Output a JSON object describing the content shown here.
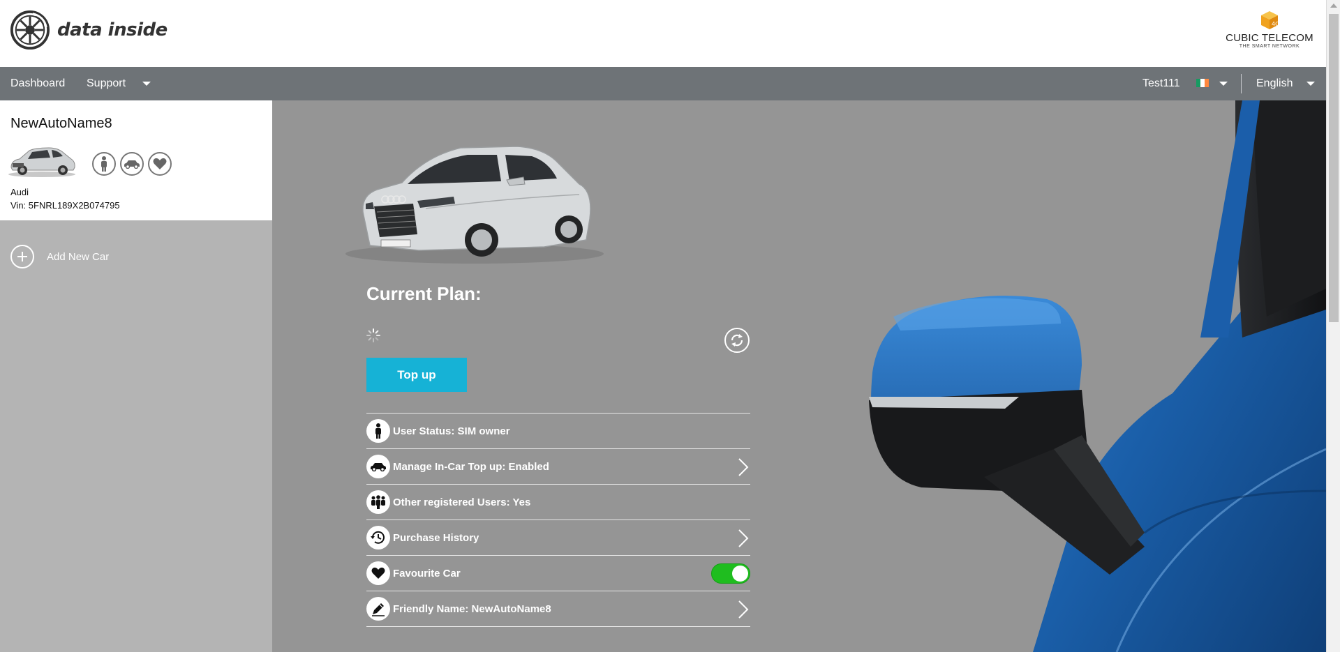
{
  "brand": {
    "name": "data inside",
    "logo_icon": "speedometer-wheel-logo"
  },
  "partner": {
    "name": "CUBIC TELECOM",
    "tagline": "THE SMART NETWORK",
    "accent": "#f5a623"
  },
  "nav": {
    "dashboard": "Dashboard",
    "support": "Support",
    "user": "Test111",
    "language": "English"
  },
  "sidebar": {
    "car": {
      "name": "NewAutoName8",
      "make": "Audi",
      "vin": "Vin: 5FNRL189X2B074795",
      "icons": [
        "person-icon",
        "car-icon",
        "heart-icon"
      ]
    },
    "add_car_label": "Add New Car"
  },
  "main": {
    "plan_title": "Current Plan:",
    "topup_label": "Top up",
    "rows": [
      {
        "label": "User Status: SIM owner",
        "icon": "person-icon",
        "action": "none"
      },
      {
        "label": "Manage In-Car Top up: Enabled",
        "icon": "car-icon",
        "action": "chevron"
      },
      {
        "label": "Other registered Users: Yes",
        "icon": "users-icon",
        "action": "none"
      },
      {
        "label": "Purchase History",
        "icon": "history-icon",
        "action": "chevron"
      },
      {
        "label": "Favourite Car",
        "icon": "heart-icon",
        "action": "toggle",
        "enabled": true
      },
      {
        "label": "Friendly Name: NewAutoName8",
        "icon": "pencil-icon",
        "action": "chevron"
      }
    ]
  },
  "colors": {
    "navbar": "#6e7377",
    "sidebar": "#b4b4b4",
    "main_bg": "#959595",
    "topup_button": "#16b2d6",
    "toggle_on": "#1fbd1f",
    "car_blue": "#1f6bb8"
  }
}
